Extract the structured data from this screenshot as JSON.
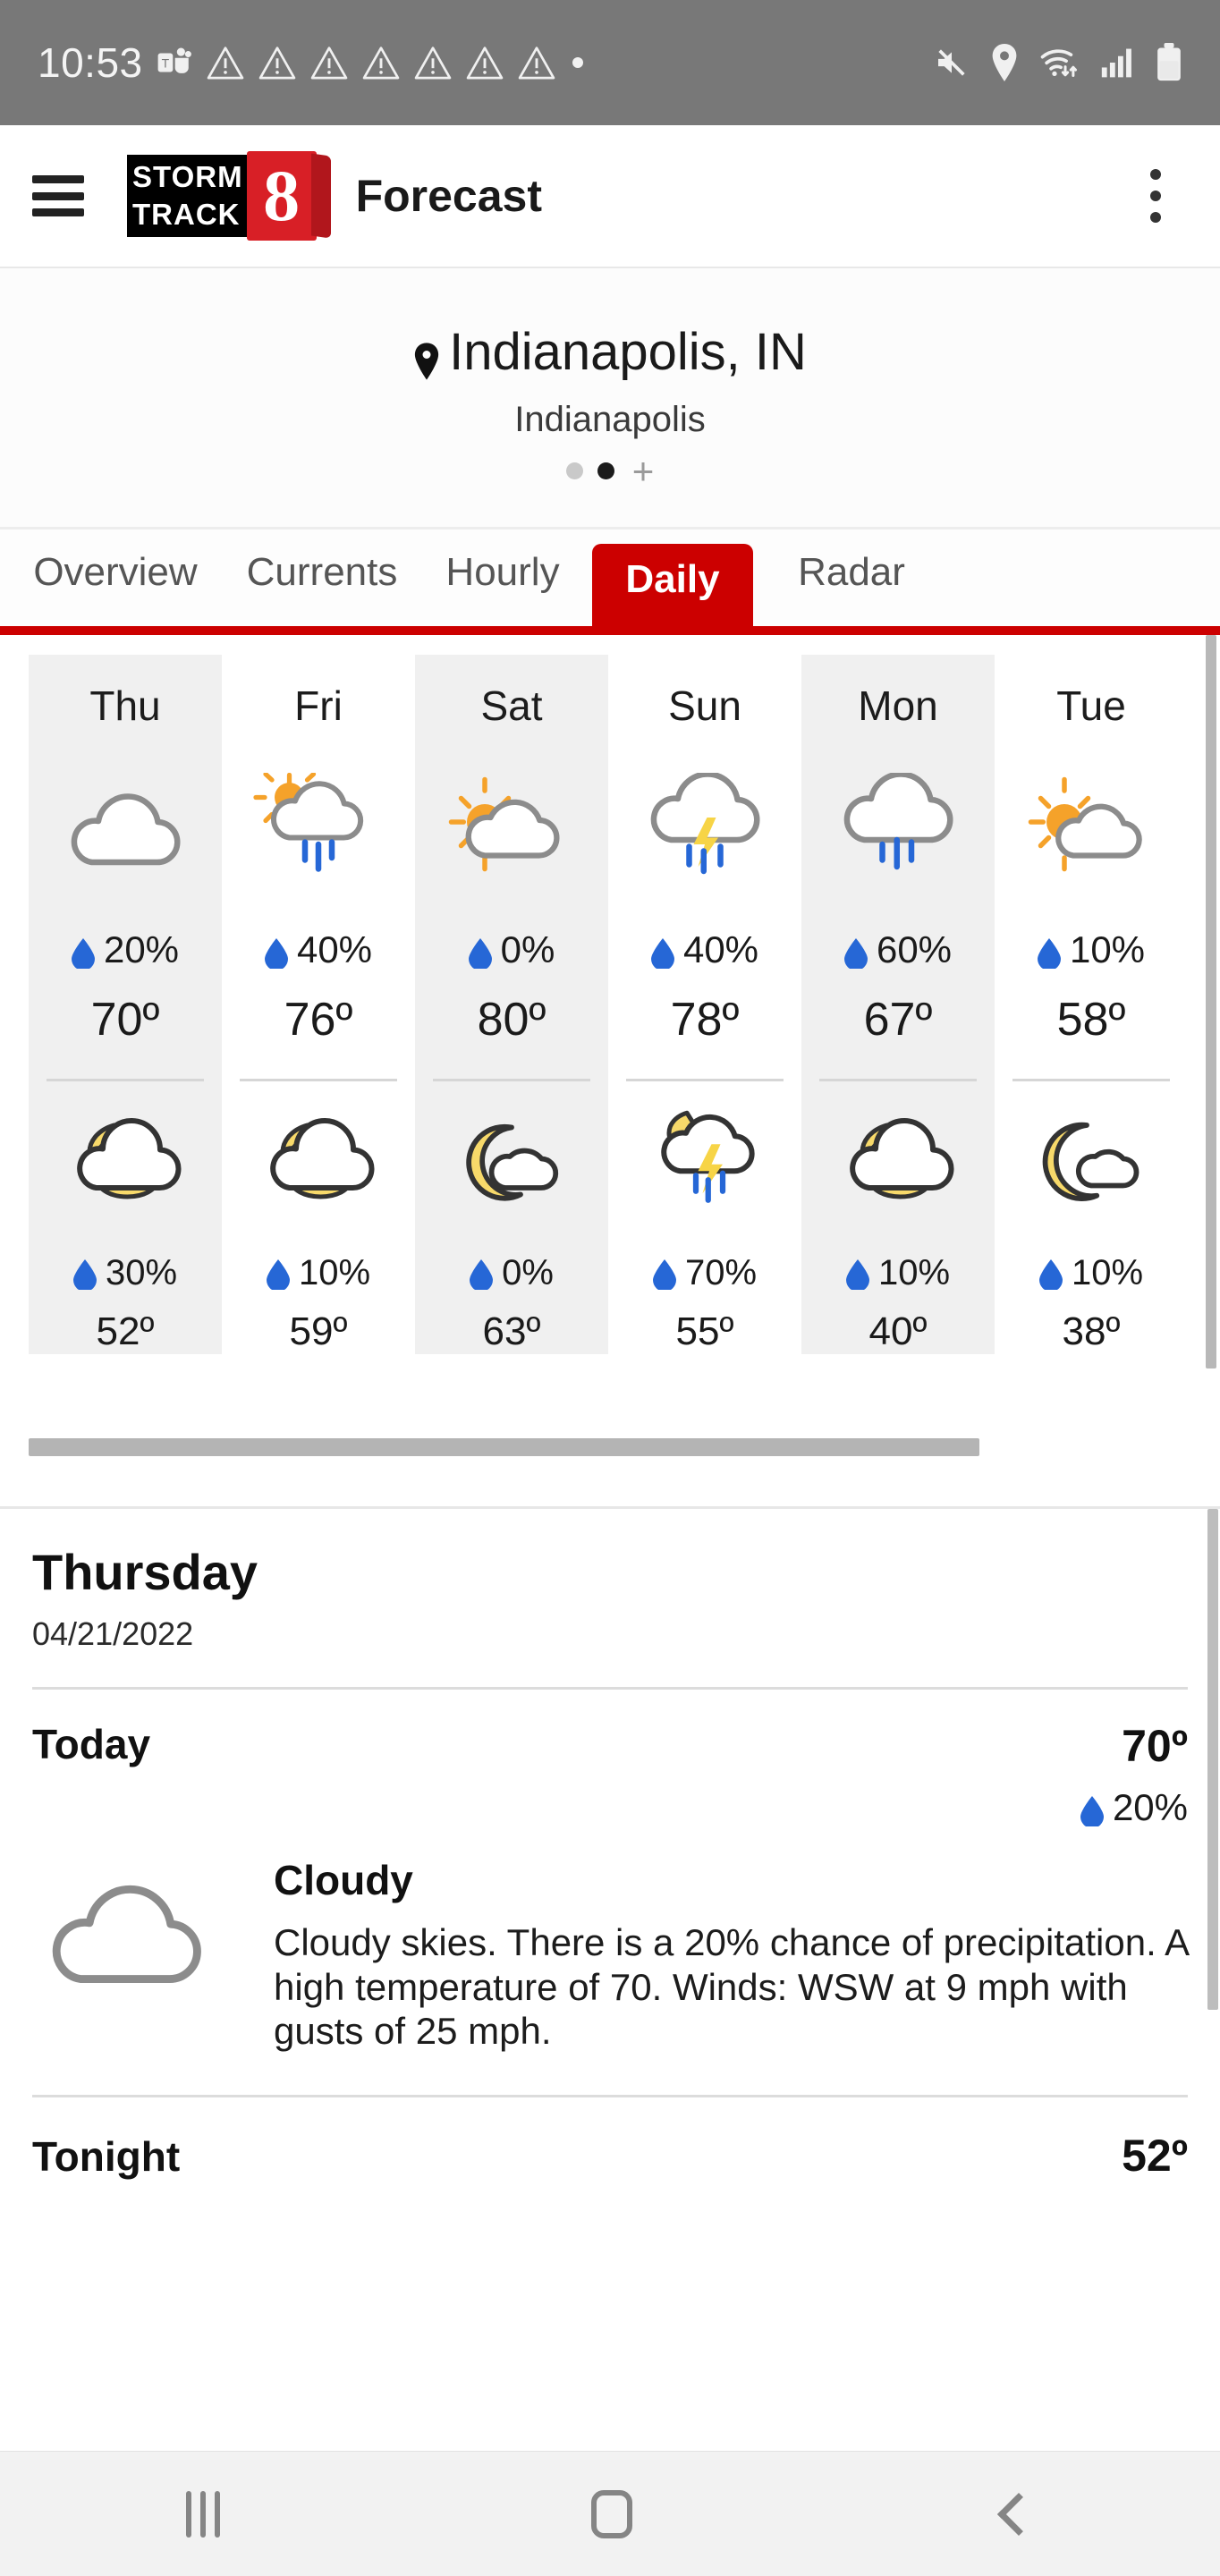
{
  "status_bar": {
    "time": "10:53",
    "teams_icon": "microsoft-teams-icon",
    "warning_count": 7,
    "icons": [
      "mute-icon",
      "location-icon",
      "wifi-icon",
      "cellular-signal-icon",
      "battery-icon"
    ]
  },
  "app_bar": {
    "menu_icon": "hamburger-menu-icon",
    "logo_line1": "STORM",
    "logo_line2": "TRACK",
    "logo_number": "8",
    "title": "Forecast",
    "overflow_icon": "kebab-menu-icon"
  },
  "location": {
    "pin_icon": "map-pin-icon",
    "name": "Indianapolis, IN",
    "sub_name": "Indianapolis",
    "pager": {
      "count": 2,
      "active_index": 1
    },
    "add_label": "+"
  },
  "tabs": {
    "items": [
      {
        "label": "Overview",
        "active": false
      },
      {
        "label": "Currents",
        "active": false
      },
      {
        "label": "Hourly",
        "active": false
      },
      {
        "label": "Daily",
        "active": true
      },
      {
        "label": "Radar",
        "active": false
      }
    ],
    "active_color": "#cc0000"
  },
  "forecast_strip": {
    "days": [
      {
        "day": "Thu",
        "shaded": true,
        "day_icon": "cloudy-icon",
        "day_pop": "20%",
        "day_temp": "70º",
        "night_icon": "moon-cloud-icon",
        "night_pop": "30%",
        "night_temp": "52º"
      },
      {
        "day": "Fri",
        "shaded": false,
        "day_icon": "sun-cloud-rain-icon",
        "day_pop": "40%",
        "day_temp": "76º",
        "night_icon": "moon-cloud-icon",
        "night_pop": "10%",
        "night_temp": "59º"
      },
      {
        "day": "Sat",
        "shaded": true,
        "day_icon": "sun-cloud-icon",
        "day_pop": "0%",
        "day_temp": "80º",
        "night_icon": "moon-small-cloud-icon",
        "night_pop": "0%",
        "night_temp": "63º"
      },
      {
        "day": "Sun",
        "shaded": false,
        "day_icon": "cloud-thunderstorm-icon",
        "day_pop": "40%",
        "day_temp": "78º",
        "night_icon": "moon-thunderstorm-icon",
        "night_pop": "70%",
        "night_temp": "55º"
      },
      {
        "day": "Mon",
        "shaded": true,
        "day_icon": "cloud-rain-icon",
        "day_pop": "60%",
        "day_temp": "67º",
        "night_icon": "moon-cloud-icon",
        "night_pop": "10%",
        "night_temp": "40º"
      },
      {
        "day": "Tue",
        "shaded": false,
        "day_icon": "sun-cloud-icon",
        "day_pop": "10%",
        "day_temp": "58º",
        "night_icon": "moon-small-cloud-icon",
        "night_pop": "10%",
        "night_temp": "38º"
      }
    ],
    "drop_icon": "water-drop-icon"
  },
  "detail": {
    "day_name": "Thursday",
    "date": "04/21/2022",
    "today": {
      "label": "Today",
      "temp": "70º",
      "pop": "20%",
      "icon": "cloudy-icon",
      "condition": "Cloudy",
      "description": "Cloudy skies. There is a 20% chance of precipitation.  A high temperature of 70.  Winds: WSW at 9 mph with gusts of 25 mph."
    },
    "tonight": {
      "label": "Tonight",
      "temp": "52º"
    }
  },
  "nav_bar": {
    "recents_icon": "recents-icon",
    "home_icon": "home-icon",
    "back_icon": "back-icon"
  },
  "colors": {
    "accent_red": "#cc0000",
    "drop_blue": "#2667d6",
    "sun_orange": "#f5a22a",
    "moon_yellow": "#f7d96a",
    "bolt_yellow": "#f7d446",
    "cloud_gray": "#8c8c8c",
    "status_bar": "#787878"
  }
}
